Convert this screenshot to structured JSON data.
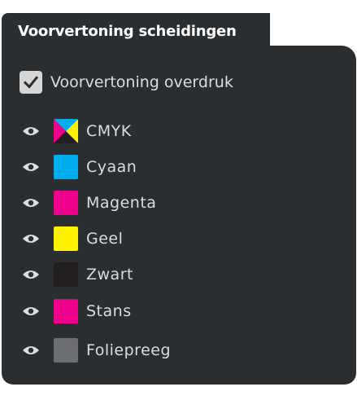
{
  "panel": {
    "title": "Voorvertoning scheidingen",
    "background_color": "#2b2e31"
  },
  "overprint": {
    "label": "Voorvertoning overdruk",
    "checked": true
  },
  "separations": [
    {
      "label": "CMYK",
      "icon": "eye-icon",
      "swatch": "cmyk-composite",
      "visible": true
    },
    {
      "label": "Cyaan",
      "icon": "eye-icon",
      "color": "#00aeef",
      "visible": true
    },
    {
      "label": "Magenta",
      "icon": "eye-icon",
      "color": "#ec008c",
      "visible": true
    },
    {
      "label": "Geel",
      "icon": "eye-icon",
      "color": "#fff200",
      "visible": true
    },
    {
      "label": "Zwart",
      "icon": "eye-icon",
      "color": "#231f20",
      "visible": true
    },
    {
      "label": "Stans",
      "icon": "eye-icon",
      "color": "#ec008c",
      "visible": true
    },
    {
      "label": "Foliepreeg",
      "icon": "eye-icon",
      "color": "#6d6e71",
      "visible": true
    }
  ]
}
